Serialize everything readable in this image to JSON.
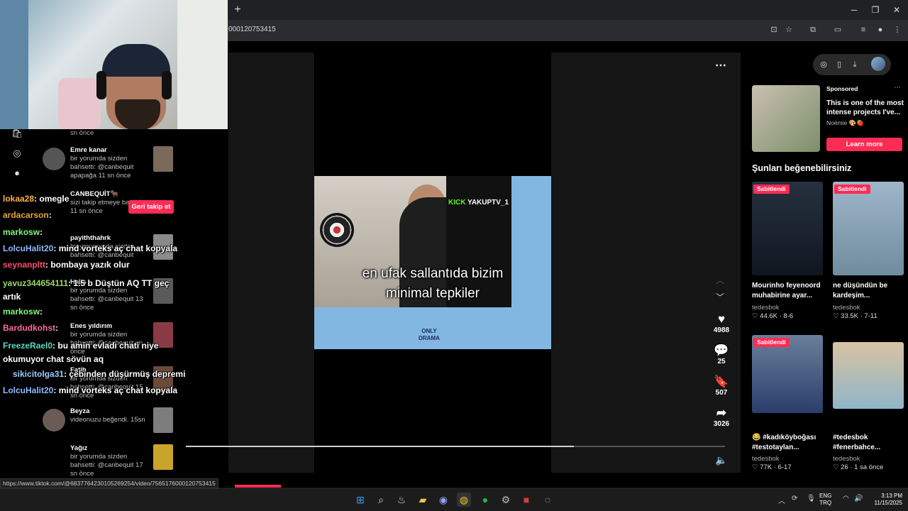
{
  "browser": {
    "url_fragment": "000120753415",
    "new_tab": "+",
    "window_controls": [
      "─",
      "❐",
      "✕"
    ]
  },
  "notifications": [
    {
      "time_tail": "sn önce"
    },
    {
      "name": "Emre kanar",
      "text": "bir yorumda sizden bahsetti: @canbequit apapağa",
      "time": "11 sn önce"
    },
    {
      "name": "CANBEQUİT🐂",
      "text": "sizi takip etmeye başladı.",
      "time": "11 sn önce"
    },
    {
      "name": "payiththahrk",
      "text": "bir yorumunda sizden bahsetti: @canbequit",
      "time": ""
    },
    {
      "name": "Halis",
      "text": "bir yorumda sizden bahsetti: @canbequit",
      "time": "13 sn önce"
    },
    {
      "name": "Enes yıldırım",
      "text": "bir yorumda sizden bahsetti: @canbequit",
      "time": "sn önce"
    },
    {
      "name": "Fatih",
      "text": "bir yorumda sizden bahsetti: @canbequit",
      "time": "15 sn önce"
    },
    {
      "name": "Beyza",
      "text": "videonuzu beğendi.",
      "time": "15sn"
    },
    {
      "name": "Yağız",
      "text": "bir yorumda sizden bahsetti: @canbequit",
      "time": "17 sn önce"
    }
  ],
  "follow_back_button": "Geri takip et",
  "chat": [
    {
      "user": "lokaa28",
      "color": "#ffb347",
      "msg": ": omegle"
    },
    {
      "user": "ardacarson",
      "color": "#e8a33a",
      "msg": ":"
    },
    {
      "user": "markosw",
      "color": "#7cfc7c",
      "msg": ":"
    },
    {
      "user": "LolcuHalit20",
      "color": "#8fb8ff",
      "msg": ": mind vorteks aç chat kopyala"
    },
    {
      "user": "seynanpltt",
      "color": "#ff4d6d",
      "msg": ": bombaya yazık olur"
    },
    {
      "user": "yavuz344654111",
      "color": "#9cd66b",
      "msg": ": 1.5 b Düştün AQ TT geç artık"
    },
    {
      "user": "markosw",
      "color": "#7cfc7c",
      "msg": ":"
    },
    {
      "user": "Bardudkohst",
      "color": "#ff6b9a",
      "msg": ":"
    },
    {
      "user": "FreezeRael0",
      "color": "#59d8c2",
      "msg": ": bu amin evladı chati niye okumuyor chat sövün aq"
    },
    {
      "user": "sikicitolga31",
      "color": "#9ecbff",
      "msg": ": çebinden düşürmüş depremi"
    },
    {
      "user": "LolcuHalit20",
      "color": "#8fb8ff",
      "msg": ": mind vorteks aç chat kopyala"
    }
  ],
  "video": {
    "kick_label": "KICK",
    "streamer_tag": "YAKUPTV_1",
    "caption_line1": "en ufak sallantıda bizim",
    "caption_line2": "minimal tepkiler",
    "watermark_line1": "ONLY",
    "watermark_line2": "DRAMA",
    "progress": 0.72
  },
  "actions": {
    "likes": "4988",
    "comments": "25",
    "saves": "507",
    "shares": "3026"
  },
  "ad": {
    "sponsored": "Sponsored",
    "title": "This is one of the most intense projects I've...",
    "author": "Noémie 🎨🍓",
    "cta": "Learn more"
  },
  "suggest_heading": "Şunları beğenebilirsiniz",
  "cards": [
    {
      "pin": "Sabitlendi",
      "caption": "Mourinho feyenoord muhabirine ayar...",
      "author": "tedesbok",
      "stats": "♡ 44.6K · 8-6"
    },
    {
      "pin": "Sabitlendi",
      "caption": "ne düşündün be kardeşim...",
      "author": "tedesbok",
      "stats": "♡ 33.5K · 7-11"
    },
    {
      "pin": "Sabitlendi",
      "caption": "😂 #kadıköyboğası #testotaylan...",
      "author": "tedesbok",
      "stats": "♡ 77K · 6-17"
    },
    {
      "pin": "",
      "caption": "#tedesbok #fenerbahce...",
      "author": "tedesbok",
      "stats": "♡ 26 · 1 sa önce"
    }
  ],
  "status_url": "https://www.tiktok.com/@6837764230105269254/video/7565176000120753415",
  "taskbar": {
    "lang_line1": "ENG",
    "lang_line2": "TRQ",
    "time": "3:13 PM",
    "date": "11/15/2025"
  },
  "colors": {
    "accent": "#fe2c55",
    "kick_green": "#53fc18"
  }
}
